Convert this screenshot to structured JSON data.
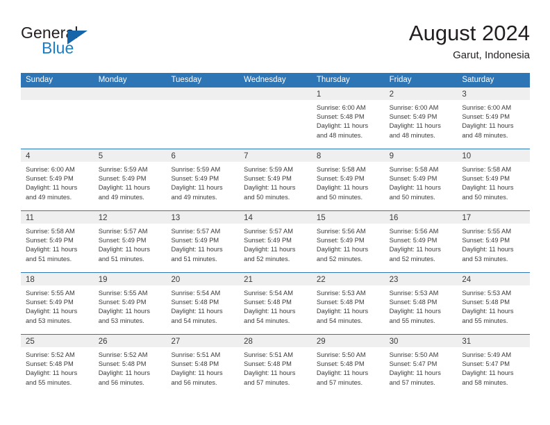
{
  "logo": {
    "word_top": "General",
    "word_bottom": "Blue",
    "triangle_color": "#1565a8",
    "blue_color": "#1a7dc4"
  },
  "header": {
    "title": "August 2024",
    "location": "Garut, Indonesia"
  },
  "theme": {
    "header_blue": "#2e75b6",
    "day_strip_gray": "#efefef",
    "text_color": "#3a3a3a"
  },
  "weekdays": [
    "Sunday",
    "Monday",
    "Tuesday",
    "Wednesday",
    "Thursday",
    "Friday",
    "Saturday"
  ],
  "weeks": [
    [
      {
        "day": "",
        "sunrise": "",
        "sunset": "",
        "daylight1": "",
        "daylight2": ""
      },
      {
        "day": "",
        "sunrise": "",
        "sunset": "",
        "daylight1": "",
        "daylight2": ""
      },
      {
        "day": "",
        "sunrise": "",
        "sunset": "",
        "daylight1": "",
        "daylight2": ""
      },
      {
        "day": "",
        "sunrise": "",
        "sunset": "",
        "daylight1": "",
        "daylight2": ""
      },
      {
        "day": "1",
        "sunrise": "Sunrise: 6:00 AM",
        "sunset": "Sunset: 5:48 PM",
        "daylight1": "Daylight: 11 hours",
        "daylight2": "and 48 minutes."
      },
      {
        "day": "2",
        "sunrise": "Sunrise: 6:00 AM",
        "sunset": "Sunset: 5:49 PM",
        "daylight1": "Daylight: 11 hours",
        "daylight2": "and 48 minutes."
      },
      {
        "day": "3",
        "sunrise": "Sunrise: 6:00 AM",
        "sunset": "Sunset: 5:49 PM",
        "daylight1": "Daylight: 11 hours",
        "daylight2": "and 48 minutes."
      }
    ],
    [
      {
        "day": "4",
        "sunrise": "Sunrise: 6:00 AM",
        "sunset": "Sunset: 5:49 PM",
        "daylight1": "Daylight: 11 hours",
        "daylight2": "and 49 minutes."
      },
      {
        "day": "5",
        "sunrise": "Sunrise: 5:59 AM",
        "sunset": "Sunset: 5:49 PM",
        "daylight1": "Daylight: 11 hours",
        "daylight2": "and 49 minutes."
      },
      {
        "day": "6",
        "sunrise": "Sunrise: 5:59 AM",
        "sunset": "Sunset: 5:49 PM",
        "daylight1": "Daylight: 11 hours",
        "daylight2": "and 49 minutes."
      },
      {
        "day": "7",
        "sunrise": "Sunrise: 5:59 AM",
        "sunset": "Sunset: 5:49 PM",
        "daylight1": "Daylight: 11 hours",
        "daylight2": "and 50 minutes."
      },
      {
        "day": "8",
        "sunrise": "Sunrise: 5:58 AM",
        "sunset": "Sunset: 5:49 PM",
        "daylight1": "Daylight: 11 hours",
        "daylight2": "and 50 minutes."
      },
      {
        "day": "9",
        "sunrise": "Sunrise: 5:58 AM",
        "sunset": "Sunset: 5:49 PM",
        "daylight1": "Daylight: 11 hours",
        "daylight2": "and 50 minutes."
      },
      {
        "day": "10",
        "sunrise": "Sunrise: 5:58 AM",
        "sunset": "Sunset: 5:49 PM",
        "daylight1": "Daylight: 11 hours",
        "daylight2": "and 50 minutes."
      }
    ],
    [
      {
        "day": "11",
        "sunrise": "Sunrise: 5:58 AM",
        "sunset": "Sunset: 5:49 PM",
        "daylight1": "Daylight: 11 hours",
        "daylight2": "and 51 minutes."
      },
      {
        "day": "12",
        "sunrise": "Sunrise: 5:57 AM",
        "sunset": "Sunset: 5:49 PM",
        "daylight1": "Daylight: 11 hours",
        "daylight2": "and 51 minutes."
      },
      {
        "day": "13",
        "sunrise": "Sunrise: 5:57 AM",
        "sunset": "Sunset: 5:49 PM",
        "daylight1": "Daylight: 11 hours",
        "daylight2": "and 51 minutes."
      },
      {
        "day": "14",
        "sunrise": "Sunrise: 5:57 AM",
        "sunset": "Sunset: 5:49 PM",
        "daylight1": "Daylight: 11 hours",
        "daylight2": "and 52 minutes."
      },
      {
        "day": "15",
        "sunrise": "Sunrise: 5:56 AM",
        "sunset": "Sunset: 5:49 PM",
        "daylight1": "Daylight: 11 hours",
        "daylight2": "and 52 minutes."
      },
      {
        "day": "16",
        "sunrise": "Sunrise: 5:56 AM",
        "sunset": "Sunset: 5:49 PM",
        "daylight1": "Daylight: 11 hours",
        "daylight2": "and 52 minutes."
      },
      {
        "day": "17",
        "sunrise": "Sunrise: 5:55 AM",
        "sunset": "Sunset: 5:49 PM",
        "daylight1": "Daylight: 11 hours",
        "daylight2": "and 53 minutes."
      }
    ],
    [
      {
        "day": "18",
        "sunrise": "Sunrise: 5:55 AM",
        "sunset": "Sunset: 5:49 PM",
        "daylight1": "Daylight: 11 hours",
        "daylight2": "and 53 minutes."
      },
      {
        "day": "19",
        "sunrise": "Sunrise: 5:55 AM",
        "sunset": "Sunset: 5:49 PM",
        "daylight1": "Daylight: 11 hours",
        "daylight2": "and 53 minutes."
      },
      {
        "day": "20",
        "sunrise": "Sunrise: 5:54 AM",
        "sunset": "Sunset: 5:48 PM",
        "daylight1": "Daylight: 11 hours",
        "daylight2": "and 54 minutes."
      },
      {
        "day": "21",
        "sunrise": "Sunrise: 5:54 AM",
        "sunset": "Sunset: 5:48 PM",
        "daylight1": "Daylight: 11 hours",
        "daylight2": "and 54 minutes."
      },
      {
        "day": "22",
        "sunrise": "Sunrise: 5:53 AM",
        "sunset": "Sunset: 5:48 PM",
        "daylight1": "Daylight: 11 hours",
        "daylight2": "and 54 minutes."
      },
      {
        "day": "23",
        "sunrise": "Sunrise: 5:53 AM",
        "sunset": "Sunset: 5:48 PM",
        "daylight1": "Daylight: 11 hours",
        "daylight2": "and 55 minutes."
      },
      {
        "day": "24",
        "sunrise": "Sunrise: 5:53 AM",
        "sunset": "Sunset: 5:48 PM",
        "daylight1": "Daylight: 11 hours",
        "daylight2": "and 55 minutes."
      }
    ],
    [
      {
        "day": "25",
        "sunrise": "Sunrise: 5:52 AM",
        "sunset": "Sunset: 5:48 PM",
        "daylight1": "Daylight: 11 hours",
        "daylight2": "and 55 minutes."
      },
      {
        "day": "26",
        "sunrise": "Sunrise: 5:52 AM",
        "sunset": "Sunset: 5:48 PM",
        "daylight1": "Daylight: 11 hours",
        "daylight2": "and 56 minutes."
      },
      {
        "day": "27",
        "sunrise": "Sunrise: 5:51 AM",
        "sunset": "Sunset: 5:48 PM",
        "daylight1": "Daylight: 11 hours",
        "daylight2": "and 56 minutes."
      },
      {
        "day": "28",
        "sunrise": "Sunrise: 5:51 AM",
        "sunset": "Sunset: 5:48 PM",
        "daylight1": "Daylight: 11 hours",
        "daylight2": "and 57 minutes."
      },
      {
        "day": "29",
        "sunrise": "Sunrise: 5:50 AM",
        "sunset": "Sunset: 5:48 PM",
        "daylight1": "Daylight: 11 hours",
        "daylight2": "and 57 minutes."
      },
      {
        "day": "30",
        "sunrise": "Sunrise: 5:50 AM",
        "sunset": "Sunset: 5:47 PM",
        "daylight1": "Daylight: 11 hours",
        "daylight2": "and 57 minutes."
      },
      {
        "day": "31",
        "sunrise": "Sunrise: 5:49 AM",
        "sunset": "Sunset: 5:47 PM",
        "daylight1": "Daylight: 11 hours",
        "daylight2": "and 58 minutes."
      }
    ]
  ]
}
